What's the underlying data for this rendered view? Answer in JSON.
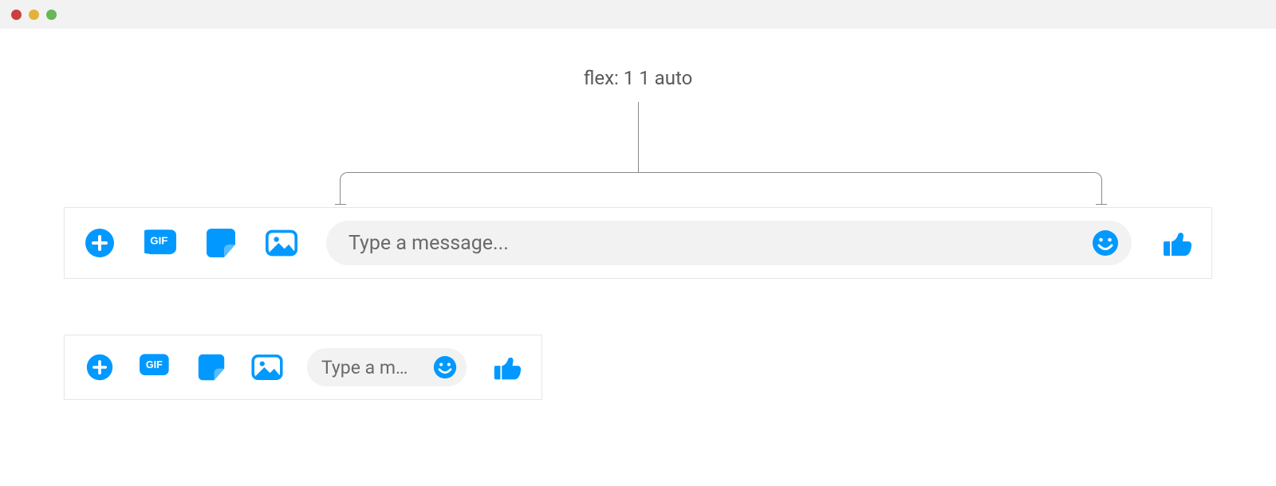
{
  "annotation": {
    "label": "flex: 1 1 auto"
  },
  "composer_wide": {
    "placeholder": "Type a message...",
    "icons": {
      "add": "plus-circle-icon",
      "gif": "gif-icon",
      "sticker": "sticker-icon",
      "photo": "photo-icon",
      "emoji": "smile-icon",
      "like": "thumbs-up-icon"
    }
  },
  "composer_narrow": {
    "placeholder_truncated": "Type a m…",
    "icons": {
      "add": "plus-circle-icon",
      "gif": "gif-icon",
      "sticker": "sticker-icon",
      "photo": "photo-icon",
      "emoji": "smile-icon",
      "like": "thumbs-up-icon"
    }
  },
  "colors": {
    "accent": "#0199ff",
    "input_bg": "#f2f2f2",
    "border": "#e6e6e6",
    "text_muted": "#6a6a6a"
  }
}
